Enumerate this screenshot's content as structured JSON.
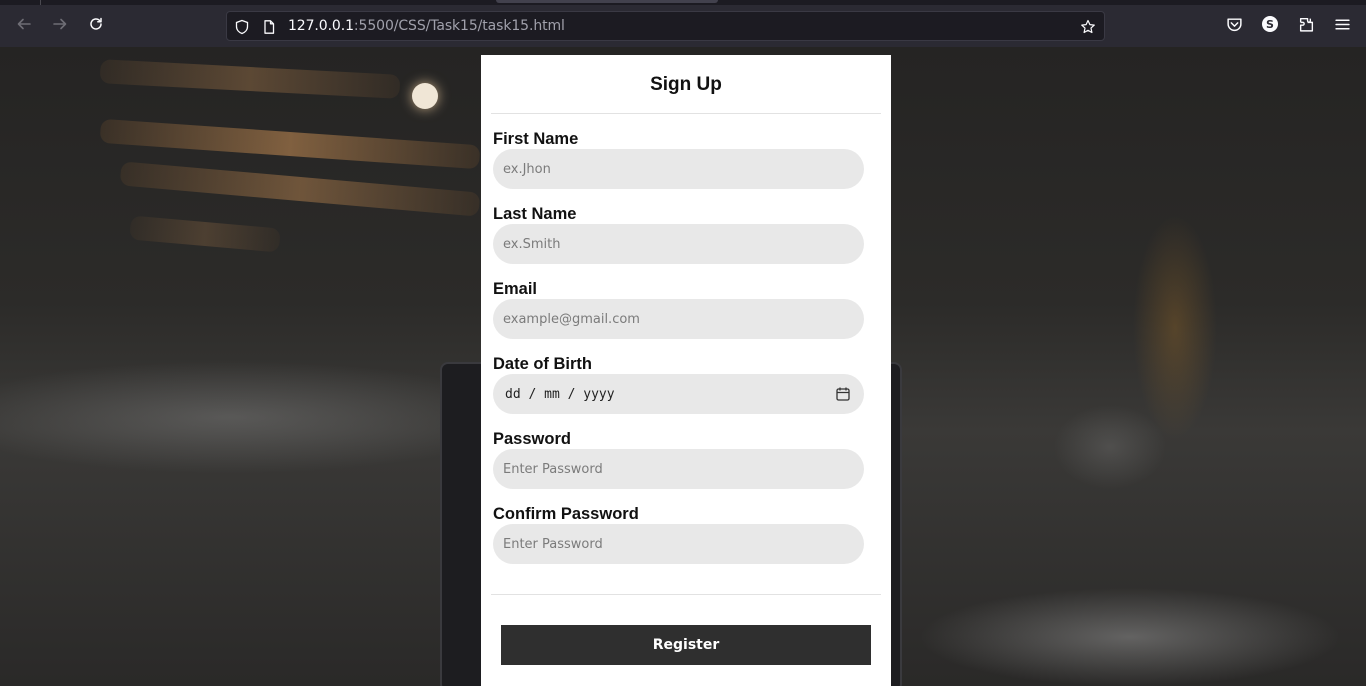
{
  "browser": {
    "url_host": "127.0.0.1",
    "url_path": ":5500/CSS/Task15/task15.html",
    "account_initial": "S"
  },
  "form": {
    "title": "Sign Up",
    "fields": [
      {
        "label": "First Name",
        "placeholder": "ex.Jhon"
      },
      {
        "label": "Last Name",
        "placeholder": "ex.Smith"
      },
      {
        "label": "Email",
        "placeholder": "example@gmail.com"
      },
      {
        "label": "Date of Birth",
        "date_format": "dd / mm / yyyy"
      },
      {
        "label": "Password",
        "placeholder": "Enter Password"
      },
      {
        "label": "Confirm Password",
        "placeholder": "Enter Password"
      }
    ],
    "submit_label": "Register"
  },
  "colors": {
    "chrome": "#2b2a33",
    "input_bg": "#e8e8e8",
    "button_bg": "#2f2f2f"
  }
}
